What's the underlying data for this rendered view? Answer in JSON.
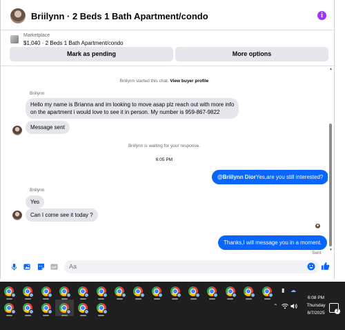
{
  "header": {
    "title": "Briilynn · 2 Beds 1 Bath Apartment/condo"
  },
  "listing": {
    "marketplace_label": "Marketplace",
    "item_text": "$1,040 · 2 Beds 1 Bath Apartment/condo",
    "mark_pending_label": "Mark as pending",
    "more_options_label": "More options"
  },
  "thread": {
    "started_text": "Briilynn started this chat.",
    "view_profile_label": "View buyer profile",
    "sender_name_1": "Briilynn",
    "message_1_line1": "Hello my name is Brianna and im looking to move asap plz reach out with more info",
    "message_1_line2": "on the apartment i would love to see it in person. My number is 959-867-9822",
    "message_2": "Message sent",
    "waiting_text": "Briilynn is waiting for your response.",
    "time_divider": "6:05 PM",
    "out_tag": "@Briilynn Dior",
    "out_message_1": "Yes,are you still interested?",
    "sender_name_2": "Briilynn",
    "message_3": "Yes",
    "message_4": "Can I come see it today ?",
    "out_message_2": "Thanks,I will message you in a moment.",
    "sent_status": "Sent"
  },
  "composer": {
    "placeholder": "Aa"
  },
  "taskbar": {
    "clock_time": "6:08 PM",
    "clock_day": "Thursday",
    "clock_date": "8/7/2025",
    "notification_count": "7",
    "row1_app_count": 15,
    "row2_app_count": 6
  },
  "colors": {
    "accent": "#0866ff",
    "info_icon": "#a033ff",
    "incoming_bubble": "#e4e6eb",
    "taskbar_bg": "#1f1f1f"
  },
  "icons": [
    "info-icon",
    "microphone-icon",
    "photo-icon",
    "sticker-icon",
    "gif-icon",
    "emoji-icon",
    "like-icon",
    "chrome-icon",
    "wifi-icon",
    "volume-icon",
    "chevron-up-icon",
    "notification-icon"
  ]
}
